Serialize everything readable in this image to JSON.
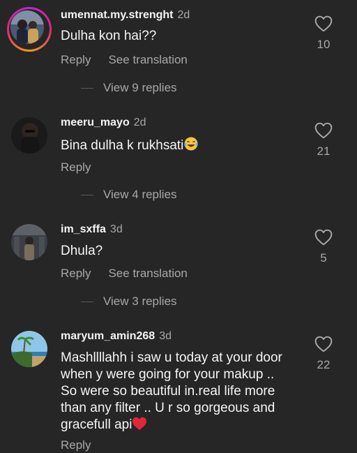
{
  "comments": [
    {
      "username": "umennat.my.strenght",
      "time": "2d",
      "text": "Dulha kon hai??",
      "likes": "10",
      "reply_label": "Reply",
      "translation_label": "See translation",
      "replies_label": "View 9 replies"
    },
    {
      "username": "meeru_mayo",
      "time": "2d",
      "text": "Bina dulha k rukhsati",
      "emoji": "laughing-tears-emoji",
      "likes": "21",
      "reply_label": "Reply",
      "replies_label": "View 4 replies"
    },
    {
      "username": "im_sxffa",
      "time": "3d",
      "text": "Dhula?",
      "likes": "5",
      "reply_label": "Reply",
      "translation_label": "See translation",
      "replies_label": "View 3 replies"
    },
    {
      "username": "maryum_amin268",
      "time": "3d",
      "lines": [
        "Mashllllahh  i saw u today at your door",
        "when y were going for your makup ..",
        "So were so beautiful  in.real life more",
        "than any filter .. U r so gorgeous and",
        "gracefull api"
      ],
      "emoji": "red-heart-emoji",
      "likes": "22",
      "reply_label": "Reply"
    }
  ],
  "colors": {
    "background": "#262626",
    "primary_text": "#f5f5f5",
    "secondary_text": "#a8a8a8",
    "story_ring": "#db2777"
  }
}
